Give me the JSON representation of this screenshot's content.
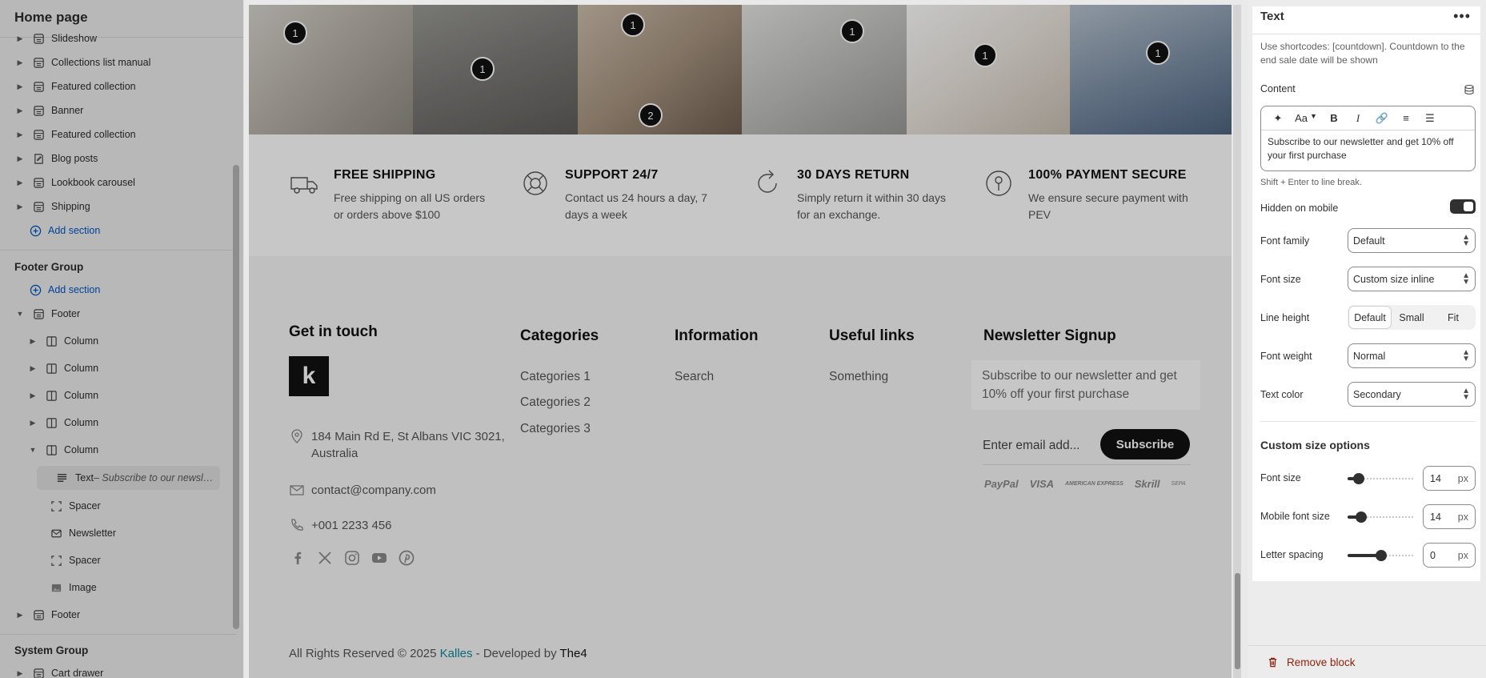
{
  "left": {
    "page_title": "Home page",
    "template_items": [
      {
        "label": "Slideshow",
        "icon": "slideshow-icon"
      },
      {
        "label": "Collections list manual",
        "icon": "section-icon"
      },
      {
        "label": "Featured collection",
        "icon": "section-icon"
      },
      {
        "label": "Banner",
        "icon": "section-icon"
      },
      {
        "label": "Featured collection",
        "icon": "section-icon"
      },
      {
        "label": "Blog posts",
        "icon": "blog-icon"
      },
      {
        "label": "Lookbook carousel",
        "icon": "section-icon"
      },
      {
        "label": "Shipping",
        "icon": "section-icon"
      }
    ],
    "add_section_label": "Add section",
    "footer_group_label": "Footer Group",
    "footer_add_section_label": "Add section",
    "footer_label": "Footer",
    "columns": [
      "Column",
      "Column",
      "Column",
      "Column",
      "Column"
    ],
    "selected_block": {
      "label": "Text",
      "separator": " – ",
      "summary": "Subscribe to our newsletter and get 10% off your first purchase"
    },
    "child_blocks": [
      {
        "label": "Spacer",
        "icon": "spacer-icon"
      },
      {
        "label": "Newsletter",
        "icon": "newsletter-icon"
      },
      {
        "label": "Spacer",
        "icon": "spacer-icon"
      },
      {
        "label": "Image",
        "icon": "image-icon"
      }
    ],
    "footer2_label": "Footer",
    "system_group_label": "System Group",
    "cart_drawer_label": "Cart drawer"
  },
  "preview": {
    "hotspots": [
      "1",
      "1",
      "1",
      "2",
      "1",
      "1",
      "1"
    ],
    "features": [
      {
        "icon": "truck-icon",
        "title": "FREE SHIPPING",
        "desc": "Free shipping on all US orders or orders above $100"
      },
      {
        "icon": "support-icon",
        "title": "SUPPORT 24/7",
        "desc": "Contact us 24 hours a day, 7 days a week"
      },
      {
        "icon": "return-icon",
        "title": "30 DAYS RETURN",
        "desc": "Simply return it within 30 days for an exchange."
      },
      {
        "icon": "secure-icon",
        "title": "100% PAYMENT SECURE",
        "desc": "We ensure secure payment with PEV"
      }
    ],
    "get_in_touch": "Get in touch",
    "logo_letter": "k",
    "address": "184 Main Rd E, St Albans VIC 3021, Australia",
    "email": "contact@company.com",
    "phone": "+001 2233 456",
    "categories": {
      "title": "Categories",
      "links": [
        "Categories 1",
        "Categories 2",
        "Categories 3"
      ]
    },
    "information": {
      "title": "Information",
      "links": [
        "Search"
      ]
    },
    "useful_links": {
      "title": "Useful links",
      "links": [
        "Something"
      ]
    },
    "newsletter": {
      "title": "Newsletter Signup",
      "text": "Subscribe to our newsletter and get 10% off your first purchase",
      "email_placeholder": "Enter email add...",
      "button_label": "Subscribe"
    },
    "payments": [
      "PayPal",
      "VISA",
      "AMERICAN EXPRESS",
      "Skrill",
      "SEPA"
    ],
    "socials": [
      "facebook-icon",
      "x-icon",
      "instagram-icon",
      "youtube-icon",
      "pinterest-icon"
    ],
    "copyright": {
      "prefix": "All Rights Reserved © 2025 ",
      "brand": "Kalles",
      "middle": " - Developed by ",
      "dev": "The4"
    }
  },
  "settings": {
    "title": "Text",
    "help": "Use shortcodes: [countdown]. Countdown to the end sale date will be shown",
    "content_label": "Content",
    "content_value": "Subscribe to our newsletter and get 10% off your first purchase",
    "editor_hint": "Shift + Enter to line break.",
    "hidden_on_mobile_label": "Hidden on mobile",
    "hidden_on_mobile": true,
    "font_family_label": "Font family",
    "font_family_value": "Default",
    "font_size_label": "Font size",
    "font_size_value": "Custom size inline",
    "line_height_label": "Line height",
    "line_height_options": [
      "Default",
      "Small",
      "Fit"
    ],
    "line_height_selected": "Default",
    "font_weight_label": "Font weight",
    "font_weight_value": "Normal",
    "text_color_label": "Text color",
    "text_color_value": "Secondary",
    "custom_size_title": "Custom size options",
    "custom_font_size_label": "Font size",
    "custom_font_size_value": "14",
    "custom_font_size_fraction": 0.1,
    "mobile_font_size_label": "Mobile font size",
    "mobile_font_size_value": "14",
    "mobile_font_size_fraction": 0.14,
    "letter_spacing_label": "Letter spacing",
    "letter_spacing_value": "0",
    "letter_spacing_fraction": 0.5,
    "unit": "px",
    "remove_block_label": "Remove block"
  },
  "colors": {
    "accent": "#005bd3",
    "danger": "#8e1f0b",
    "brand_link": "#0e8a9a"
  }
}
